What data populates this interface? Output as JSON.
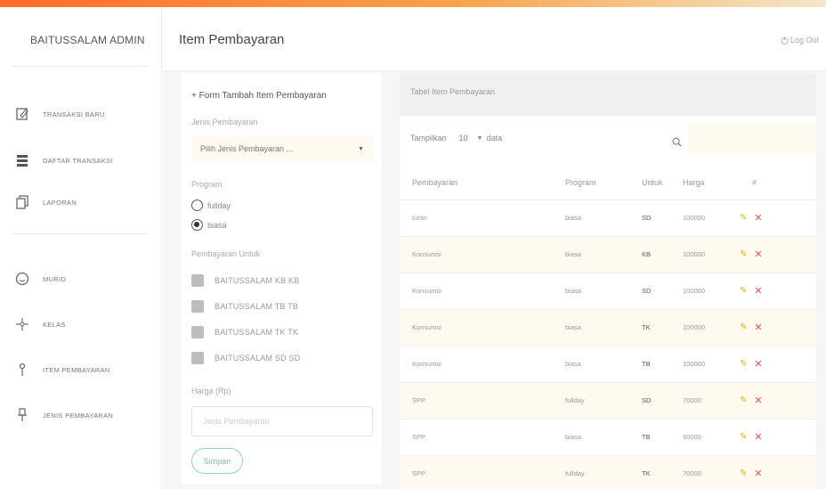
{
  "app": {
    "brand": "BAITUSSALAM ADMIN"
  },
  "sidebar": {
    "items": [
      {
        "label": "TRANSAKSI BARU",
        "icon": "edit-icon"
      },
      {
        "label": "DAFTAR TRANSAKSI",
        "icon": "list-icon"
      },
      {
        "label": "LAPORAN",
        "icon": "copy-icon"
      },
      {
        "label": "MURID",
        "icon": "smile-icon"
      },
      {
        "label": "KELAS",
        "icon": "cross-icon"
      },
      {
        "label": "ITEM PEMBAYARAN",
        "icon": "pin-icon"
      },
      {
        "label": "JENIS PEMBAYARAN",
        "icon": "push-pin-icon"
      }
    ]
  },
  "header": {
    "title": "Item Pembayaran",
    "logout_label": "Log Out"
  },
  "form": {
    "title": "+ Form Tambah Item Pembayaran",
    "jenis_label": "Jenis Pembayaran",
    "jenis_value": "Pilih Jenis Pembayaran ...",
    "program_label": "Program",
    "program_options": [
      {
        "label": "fullday",
        "selected": false
      },
      {
        "label": "biasa",
        "selected": true
      }
    ],
    "untuk_label": "Pembayaran Untuk",
    "untuk_options": [
      "BAITUSSALAM KB KB",
      "BAITUSSALAM TB TB",
      "BAITUSSALAM TK TK",
      "BAITUSSALAM SD SD"
    ],
    "harga_label": "Harga (Rp)",
    "harga_placeholder": "Jenis Pembayaran",
    "save_label": "Simpan"
  },
  "table": {
    "title": "Tabel Item Pembayaran",
    "show_label": "Tampilkan",
    "page_length": "10",
    "entries_label": "data",
    "columns": [
      "Pembayaran",
      "Program",
      "Untuk",
      "Harga",
      "#"
    ],
    "rows": [
      {
        "pembayaran": "Iuran",
        "program": "biasa",
        "untuk": "SD",
        "harga": "100000"
      },
      {
        "pembayaran": "Konsumsi",
        "program": "biasa",
        "untuk": "KB",
        "harga": "100000"
      },
      {
        "pembayaran": "Konsumsi",
        "program": "biasa",
        "untuk": "SD",
        "harga": "100000"
      },
      {
        "pembayaran": "Konsumsi",
        "program": "biasa",
        "untuk": "TK",
        "harga": "100000"
      },
      {
        "pembayaran": "Konsumsi",
        "program": "biasa",
        "untuk": "TB",
        "harga": "100000"
      },
      {
        "pembayaran": "SPP",
        "program": "fullday",
        "untuk": "SD",
        "harga": "70000"
      },
      {
        "pembayaran": "SPP",
        "program": "biasa",
        "untuk": "TB",
        "harga": "50000"
      },
      {
        "pembayaran": "SPP",
        "program": "fullday",
        "untuk": "TK",
        "harga": "70000"
      }
    ]
  },
  "colors": {
    "accent_orange": "#ff6b2b",
    "row_highlight": "#fffaef",
    "edit": "#e8b400",
    "delete": "#ff4d4d",
    "save_border": "#8fd4c4"
  }
}
